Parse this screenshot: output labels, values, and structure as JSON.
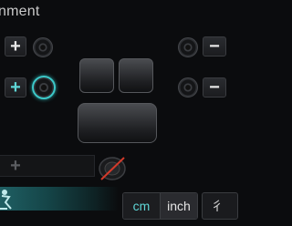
{
  "header": {
    "title": "nment"
  },
  "controls": {
    "plus": "+",
    "minus": "−"
  },
  "units": {
    "options": [
      "cm",
      "inch"
    ],
    "selected": "cm"
  },
  "extra_button": "彳",
  "colors": {
    "accent": "#3cc8c8",
    "mute_slash": "#d23a2a",
    "background": "#0b0c0e"
  }
}
